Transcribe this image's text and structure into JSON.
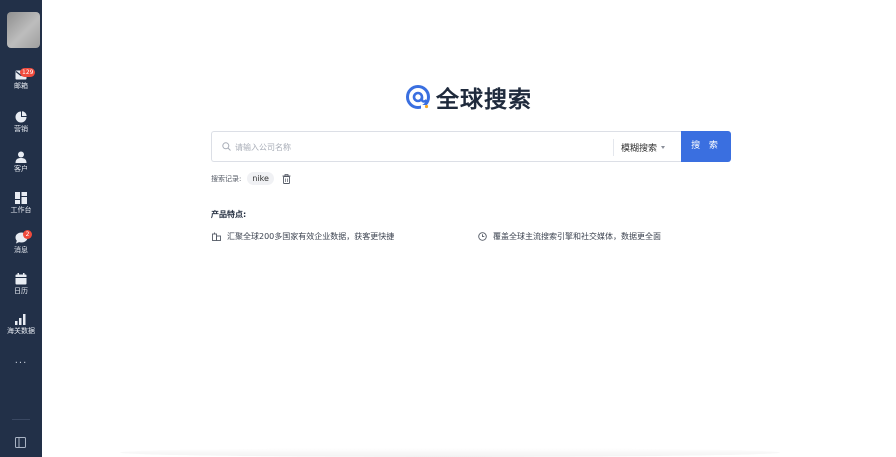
{
  "sidebar": {
    "items": [
      {
        "label": "邮箱",
        "icon": "mail-icon",
        "badge": "129"
      },
      {
        "label": "营销",
        "icon": "pie-chart-icon"
      },
      {
        "label": "客户",
        "icon": "user-icon"
      },
      {
        "label": "工作台",
        "icon": "dashboard-icon"
      },
      {
        "label": "消息",
        "icon": "chat-icon",
        "badge": "2"
      },
      {
        "label": "日历",
        "icon": "calendar-icon"
      },
      {
        "label": "海关数据",
        "icon": "bar-chart-icon"
      }
    ],
    "more": "···"
  },
  "logo": {
    "text": "全球搜索"
  },
  "search": {
    "placeholder": "请输入公司名称",
    "value": "",
    "mode": "模糊搜索",
    "button": "搜 索"
  },
  "history": {
    "label": "搜索记录:",
    "chips": [
      "nike"
    ]
  },
  "features": {
    "title": "产品特点:",
    "items": [
      "汇聚全球200多国家有效企业数据，获客更快捷",
      "覆盖全球主流搜索引擎和社交媒体，数据更全面"
    ]
  },
  "colors": {
    "sidebar": "#223048",
    "accent": "#3a6fe0",
    "badge": "#f04a3c"
  }
}
